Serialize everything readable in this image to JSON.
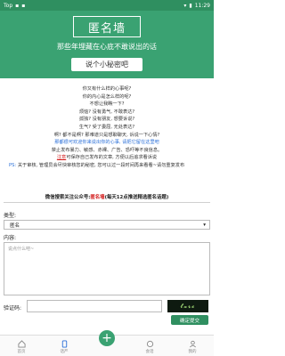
{
  "status": {
    "left_time": "Top",
    "right_time": "11:29"
  },
  "hero": {
    "title": "匿名墙",
    "subtitle": "那些年埋藏在心底不敢说出的话",
    "button": "说个小秘密吧"
  },
  "poem": {
    "line1": "你又有什么样的心事呢?",
    "line2": "你的内心是怎么样的呢?",
    "line3": "不想让我瞧一下?",
    "line4": "烦恼? 没有勇气, 不敢表达?",
    "line5": "孤独? 没有朋友, 想要诉说?",
    "line6": "生气? 受了委屈, 无处表达?",
    "line7": "啊? 都不是啊? 那难道只是想聊聊天, 诉说一下心情?",
    "line8": "那都很可欢迎你来说出你的心事, 请把它留在这里吧",
    "line9": "禁止发布暴力、敏感、赤裸、广告、恐吓等不良信息。",
    "line10_red": "注意",
    "line10": "可保存自己发布的文章, 方便以后追求看诉说",
    "ps_label": "PS:",
    "ps_text": "关于审核, 管理员会尽快审核您的秘密, 您可以过一段时间再来看看~请勿重复发布"
  },
  "wechat": {
    "prefix": "微信搜索关注公众号:",
    "name": "匿名墙",
    "suffix": "(每天12点推送精选匿名话题)"
  },
  "form": {
    "type_label": "类型:",
    "type_value": "匿名",
    "content_label": "内容:",
    "content_placeholder": "说点什么吧~",
    "verify_label": "验证码:",
    "captcha_text": "𝓽𝔁𝓻𝓬",
    "submit": "确定提交"
  },
  "tabs": [
    {
      "label": "首页",
      "icon": "home-icon"
    },
    {
      "label": "话严",
      "icon": "phone-icon"
    },
    {
      "label": "",
      "icon": "plus-icon"
    },
    {
      "label": "会话",
      "icon": "chat-icon"
    },
    {
      "label": "我的",
      "icon": "user-icon"
    }
  ]
}
